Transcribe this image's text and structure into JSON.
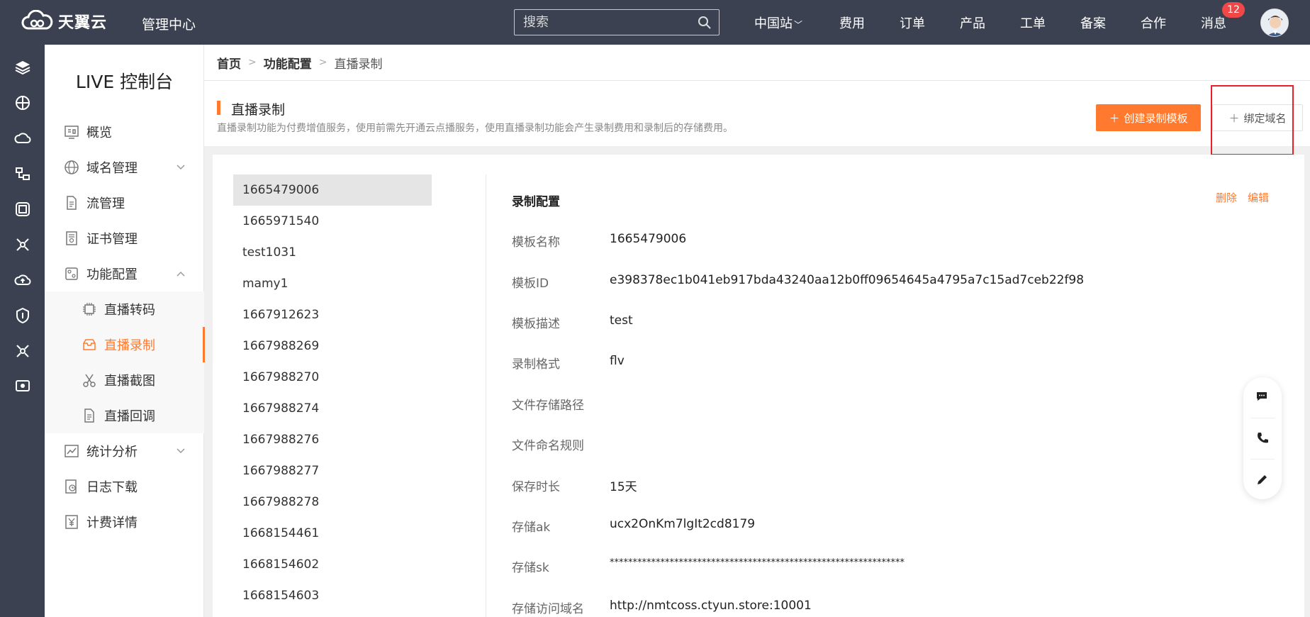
{
  "topbar": {
    "brand": "天翼云",
    "management": "管理中心",
    "search_placeholder": "搜索",
    "nav": [
      "中国站",
      "费用",
      "订单",
      "产品",
      "工单",
      "备案",
      "合作",
      "消息"
    ],
    "message_badge": "12"
  },
  "sidebar": {
    "title": "LIVE 控制台",
    "items": [
      {
        "label": "概览",
        "icon": "overview-icon"
      },
      {
        "label": "域名管理",
        "icon": "globe-icon",
        "expandable": true
      },
      {
        "label": "流管理",
        "icon": "document-icon"
      },
      {
        "label": "证书管理",
        "icon": "certificate-icon"
      },
      {
        "label": "功能配置",
        "icon": "config-icon",
        "expanded": true
      },
      {
        "label": "直播转码",
        "icon": "chip-icon",
        "sub": true
      },
      {
        "label": "直播录制",
        "icon": "record-icon",
        "sub": true,
        "active": true
      },
      {
        "label": "直播截图",
        "icon": "scissors-icon",
        "sub": true
      },
      {
        "label": "直播回调",
        "icon": "document-icon",
        "sub": true
      },
      {
        "label": "统计分析",
        "icon": "chart-icon",
        "expandable": true
      },
      {
        "label": "日志下载",
        "icon": "log-icon"
      },
      {
        "label": "计费详情",
        "icon": "yen-icon"
      }
    ]
  },
  "breadcrumb": [
    "首页",
    "功能配置",
    "直播录制"
  ],
  "page": {
    "title": "直播录制",
    "description": "直播录制功能为付费增值服务，使用前需先开通云点播服务，使用直播录制功能会产生录制费用和录制后的存储费用。",
    "create_button": "创建录制模板",
    "bind_button": "绑定域名"
  },
  "templates": [
    "1665479006",
    "1665971540",
    "test1031",
    "mamy1",
    "1667912623",
    "1667988269",
    "1667988270",
    "1667988274",
    "1667988276",
    "1667988277",
    "1667988278",
    "1668154461",
    "1668154602",
    "1668154603"
  ],
  "selected_template": "1665479006",
  "detail": {
    "title": "录制配置",
    "delete_label": "删除",
    "edit_label": "编辑",
    "fields": [
      {
        "label": "模板名称",
        "value": "1665479006"
      },
      {
        "label": "模板ID",
        "value": "e398378ec1b041eb917bda43240aa12b0ff09654645a4795a7c15ad7ceb22f98"
      },
      {
        "label": "模板描述",
        "value": "test"
      },
      {
        "label": "录制格式",
        "value": "flv"
      },
      {
        "label": "文件存储路径",
        "value": ""
      },
      {
        "label": "文件命名规则",
        "value": ""
      },
      {
        "label": "保存时长",
        "value": "15天"
      },
      {
        "label": "存储ak",
        "value": "ucx2OnKm7lgIt2cd8179"
      },
      {
        "label": "存储sk",
        "value": "****************************************************************"
      },
      {
        "label": "存储访问域名",
        "value": "http://nmtcoss.ctyun.store:10001"
      }
    ]
  },
  "colors": {
    "accent": "#ff7a2e",
    "topbar": "#3b4150",
    "highlight_box": "#e8202a"
  }
}
